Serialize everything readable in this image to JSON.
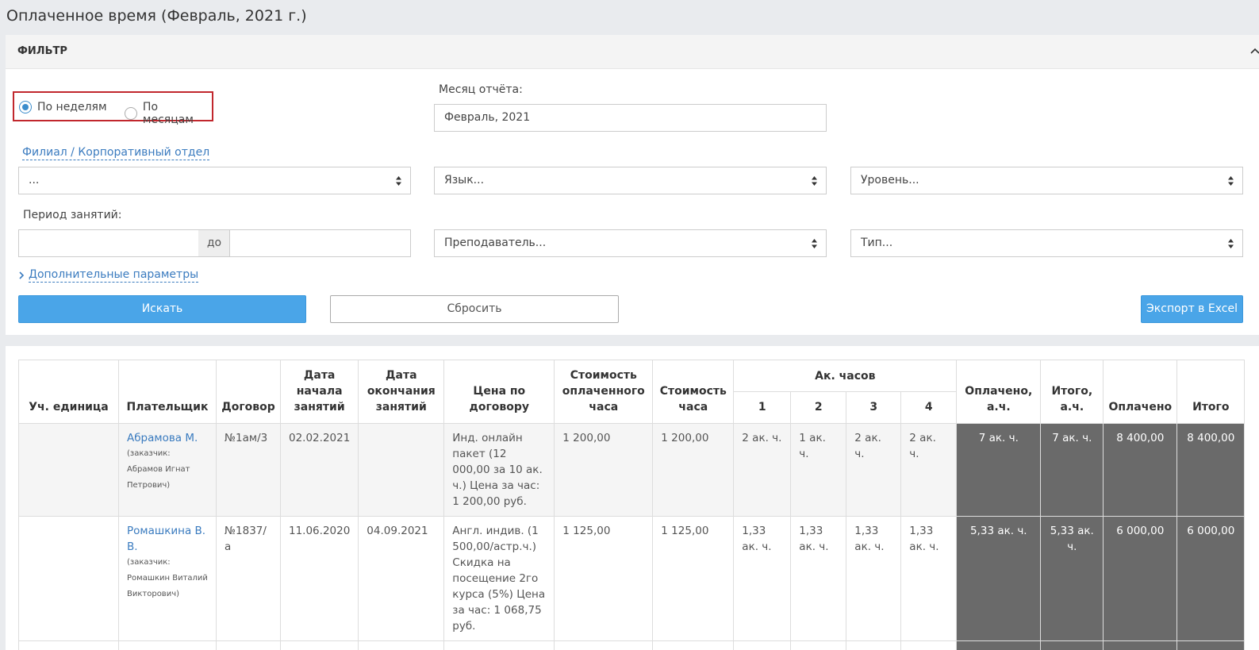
{
  "page_title": "Оплаченное время (Февраль, 2021 г.)",
  "filter": {
    "title": "ФИЛЬТР",
    "radio": {
      "by_weeks": "По неделям",
      "by_months": "По месяцам",
      "selected": "by_weeks"
    },
    "report_month_label": "Месяц отчёта:",
    "report_month_value": "Февраль, 2021",
    "branch_link": "Филиал / Корпоративный отдел",
    "branch_select": "...",
    "language_select": "Язык...",
    "level_select": "Уровень...",
    "period_label": "Период занятий:",
    "period_to": "до",
    "period_from_value": "",
    "period_to_value": "",
    "teacher_select": "Преподаватель...",
    "type_select": "Тип...",
    "more_params": "Дополнительные параметры",
    "search_btn": "Искать",
    "reset_btn": "Сбросить",
    "export_btn": "Экспорт в Excel"
  },
  "table": {
    "headers": {
      "unit": "Уч. единица",
      "payer": "Плательщик",
      "contract": "Договор",
      "start_date": "Дата начала занятий",
      "end_date": "Дата окончания занятий",
      "price": "Цена по договору",
      "paid_hour_cost": "Стоимость оплаченного часа",
      "hour_cost": "Стоимость часа",
      "ac_hours": "Ак. часов",
      "w1": "1",
      "w2": "2",
      "w3": "3",
      "w4": "4",
      "paid_ah": "Оплачено, а.ч.",
      "total_ah": "Итого, а.ч.",
      "paid": "Оплачено",
      "total": "Итого"
    },
    "rows": [
      {
        "unit": "",
        "payer": "Абрамова М.",
        "payer_note": "(заказчик: Абрамов Игнат Петрович)",
        "contract": "№1ам/3",
        "start_date": "02.02.2021",
        "end_date": "",
        "price": "Инд. онлайн пакет (12 000,00 за 10 ак. ч.) Цена за час: 1 200,00 руб.",
        "paid_hour_cost": "1 200,00",
        "hour_cost": "1 200,00",
        "w1": "2 ак. ч.",
        "w2": "1 ак. ч.",
        "w3": "2 ак. ч.",
        "w4": "2 ак. ч.",
        "paid_ah": "7 ак. ч.",
        "total_ah": "7 ак. ч.",
        "paid": "8 400,00",
        "total": "8 400,00"
      },
      {
        "unit": "",
        "payer": "Ромашкина В. В.",
        "payer_note": "(заказчик: Ромашкин Виталий Викторович)",
        "contract": "№1837/а",
        "start_date": "11.06.2020",
        "end_date": "04.09.2021",
        "price": "Англ. индив. (1 500,00/астр.ч.) Скидка на посещение 2го курса (5%) Цена за час: 1 068,75 руб.",
        "paid_hour_cost": "1 125,00",
        "hour_cost": "1 125,00",
        "w1": "1,33 ак. ч.",
        "w2": "1,33 ак. ч.",
        "w3": "1,33 ак. ч.",
        "w4": "1,33 ак. ч.",
        "paid_ah": "5,33 ак. ч.",
        "total_ah": "5,33 ак. ч.",
        "paid": "6 000,00",
        "total": "6 000,00"
      }
    ]
  }
}
